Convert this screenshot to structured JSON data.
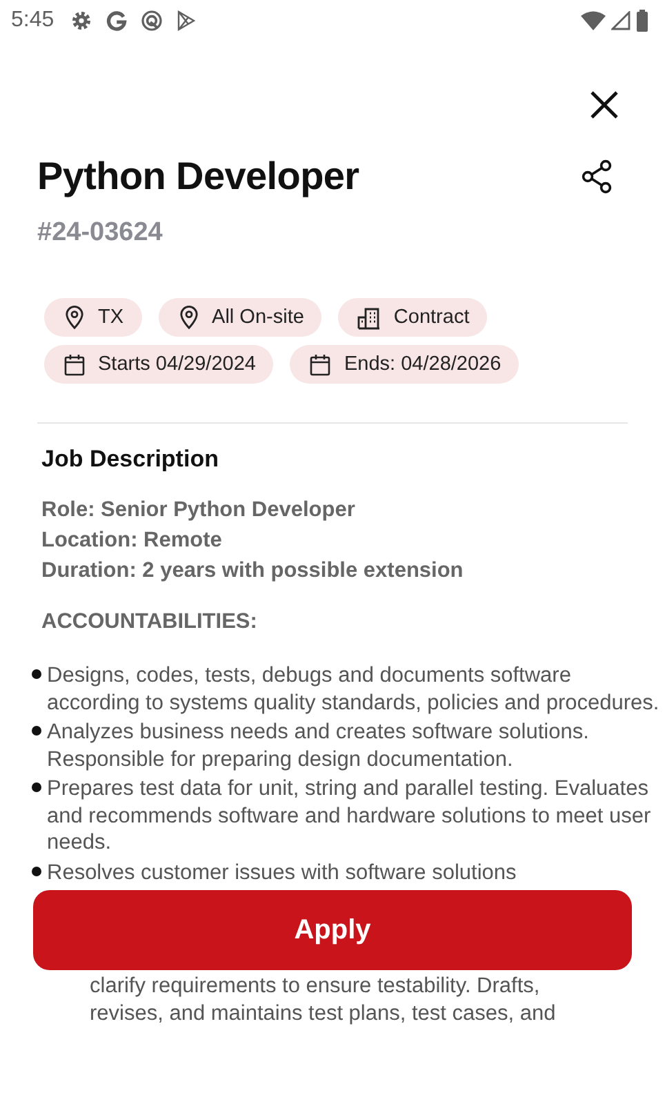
{
  "status_bar": {
    "time": "5:45"
  },
  "job": {
    "title": "Python Developer",
    "id": "#24-03624"
  },
  "chips": [
    {
      "kind": "location",
      "label": "TX"
    },
    {
      "kind": "location",
      "label": "All On-site"
    },
    {
      "kind": "building",
      "label": "Contract"
    },
    {
      "kind": "calendar",
      "label": "Starts 04/29/2024"
    },
    {
      "kind": "calendar",
      "label": "Ends: 04/28/2026"
    }
  ],
  "description": {
    "heading": "Job Description",
    "summary": [
      "Role: Senior Python Developer",
      "Location: Remote",
      "Duration: 2 years with possible extension"
    ],
    "section_heading": "ACCOUNTABILITIES:",
    "bullets": [
      "Designs, codes, tests, debugs and documents software according to systems quality standards, policies and procedures.",
      "Analyzes business needs and creates software solutions. Responsible for preparing design documentation.",
      "Prepares test data for unit, string and parallel testing. Evaluates and recommends software and hardware solutions to meet user needs.",
      "Resolves customer issues with software solutions"
    ],
    "continuation_lines": [
      "clarify requirements to ensure testability. Drafts,",
      "revises, and maintains test plans, test cases, and"
    ]
  },
  "apply_button": "Apply"
}
